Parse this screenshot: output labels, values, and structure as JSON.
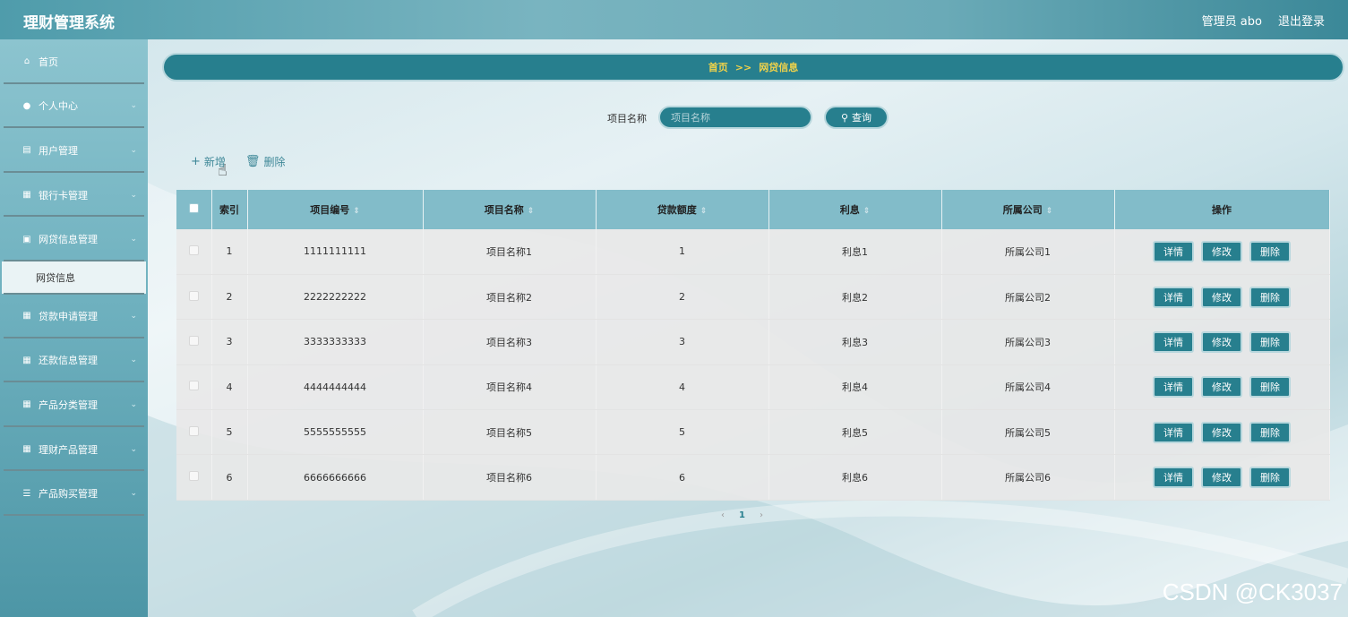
{
  "header": {
    "app_title": "理财管理系统",
    "user_label": "管理员 abo",
    "logout_label": "退出登录"
  },
  "sidebar": {
    "items": [
      {
        "label": "首页",
        "icon": "home-icon"
      },
      {
        "label": "个人中心",
        "icon": "user-icon"
      },
      {
        "label": "用户管理",
        "icon": "id-card-icon"
      },
      {
        "label": "银行卡管理",
        "icon": "grid-icon"
      },
      {
        "label": "网贷信息管理",
        "icon": "monitor-icon"
      },
      {
        "label": "贷款申请管理",
        "icon": "grid-icon"
      },
      {
        "label": "还款信息管理",
        "icon": "grid-icon"
      },
      {
        "label": "产品分类管理",
        "icon": "grid-icon"
      },
      {
        "label": "理财产品管理",
        "icon": "grid-icon"
      },
      {
        "label": "产品购买管理",
        "icon": "menu-icon"
      }
    ],
    "submenu_active": "网贷信息"
  },
  "breadcrumb": {
    "home": "首页",
    "separator": ">>",
    "current": "网贷信息"
  },
  "search": {
    "label": "项目名称",
    "placeholder": "项目名称",
    "button_label": "查询"
  },
  "actions": {
    "add_label": "新增",
    "delete_label": "删除"
  },
  "table": {
    "columns": [
      "索引",
      "项目编号",
      "项目名称",
      "贷款额度",
      "利息",
      "所属公司",
      "操作"
    ],
    "rows": [
      {
        "index": "1",
        "code": "1111111111",
        "name": "项目名称1",
        "amount": "1",
        "interest": "利息1",
        "company": "所属公司1"
      },
      {
        "index": "2",
        "code": "2222222222",
        "name": "项目名称2",
        "amount": "2",
        "interest": "利息2",
        "company": "所属公司2"
      },
      {
        "index": "3",
        "code": "3333333333",
        "name": "项目名称3",
        "amount": "3",
        "interest": "利息3",
        "company": "所属公司3"
      },
      {
        "index": "4",
        "code": "4444444444",
        "name": "项目名称4",
        "amount": "4",
        "interest": "利息4",
        "company": "所属公司4"
      },
      {
        "index": "5",
        "code": "5555555555",
        "name": "项目名称5",
        "amount": "5",
        "interest": "利息5",
        "company": "所属公司5"
      },
      {
        "index": "6",
        "code": "6666666666",
        "name": "项目名称6",
        "amount": "6",
        "interest": "利息6",
        "company": "所属公司6"
      }
    ],
    "row_actions": {
      "detail": "详情",
      "edit": "修改",
      "delete": "删除"
    }
  },
  "pagination": {
    "prev": "‹",
    "current": "1",
    "next": "›"
  },
  "watermark": "CSDN @CK3037",
  "colors": {
    "accent": "#277f8e",
    "breadcrumb_text": "#f0d24a",
    "header_bg": "#82bcc9"
  }
}
